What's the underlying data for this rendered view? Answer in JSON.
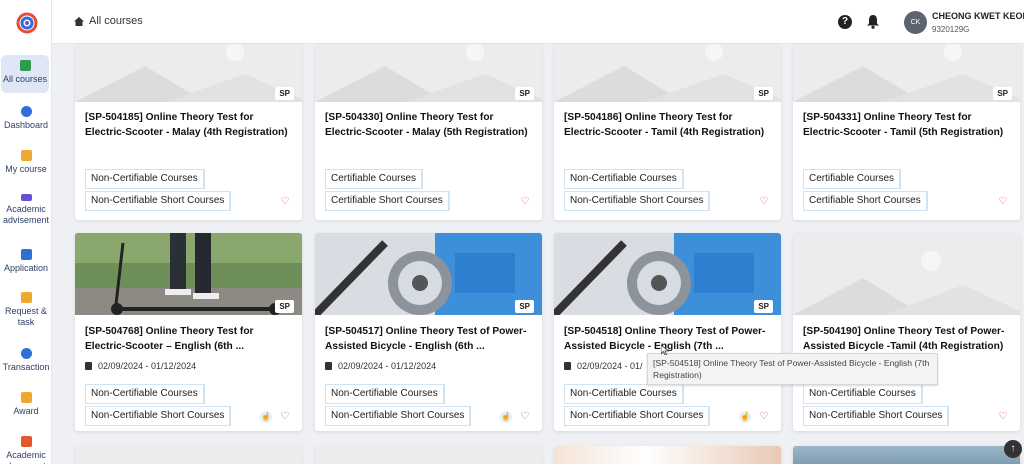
{
  "header": {
    "breadcrumb": "All courses",
    "help_icon": "?",
    "user": {
      "initials": "CK",
      "name": "CHEONG KWET KEONG",
      "id": "9320129G"
    }
  },
  "sidebar": {
    "items": [
      {
        "label": "All courses",
        "color": "#2e9b4e"
      },
      {
        "label": "Dashboard",
        "color": "#2f6fd6"
      },
      {
        "label": "My course",
        "color": "#f0a830"
      },
      {
        "label": "Academic advisement",
        "color": "#6b4fd6"
      },
      {
        "label": "Application",
        "color": "#2f6fd6"
      },
      {
        "label": "Request & task",
        "color": "#f0a830"
      },
      {
        "label": "Transaction",
        "color": "#2f6fd6"
      },
      {
        "label": "Award",
        "color": "#f0a830"
      },
      {
        "label": "Academic document",
        "color": "#e2572e"
      }
    ]
  },
  "cards": [
    {
      "badge": "SP",
      "title": "[SP-504185] Online Theory Test for Electric-Scooter - Malay (4th Registration)",
      "date": "",
      "tags": [
        "Non-Certifiable Courses",
        "Non-Certifiable Short Courses"
      ]
    },
    {
      "badge": "SP",
      "title": "[SP-504330] Online Theory Test for Electric-Scooter - Malay (5th Registration)",
      "date": "",
      "tags": [
        "Certifiable Courses",
        "Certifiable Short Courses"
      ]
    },
    {
      "badge": "SP",
      "title": "[SP-504186] Online Theory Test for Electric-Scooter - Tamil (4th Registration)",
      "date": "",
      "tags": [
        "Non-Certifiable Courses",
        "Non-Certifiable Short Courses"
      ]
    },
    {
      "badge": "SP",
      "title": "[SP-504331] Online Theory Test for Electric-Scooter - Tamil (5th Registration)",
      "date": "",
      "tags": [
        "Certifiable Courses",
        "Certifiable Short Courses"
      ]
    },
    {
      "badge": "SP",
      "title": "[SP-504768] Online Theory Test for Electric-Scooter – English (6th ...",
      "date": "02/09/2024 - 01/12/2024",
      "tags": [
        "Non-Certifiable Courses",
        "Non-Certifiable Short Courses"
      ]
    },
    {
      "badge": "SP",
      "title": "[SP-504517] Online Theory Test of Power-Assisted Bicycle - English (6th ...",
      "date": "02/09/2024 - 01/12/2024",
      "tags": [
        "Non-Certifiable Courses",
        "Non-Certifiable Short Courses"
      ]
    },
    {
      "badge": "SP",
      "title": "[SP-504518] Online Theory Test of Power-Assisted Bicycle - English (7th ...",
      "date": "02/09/2024 - 01/",
      "tags": [
        "Non-Certifiable Courses",
        "Non-Certifiable Short Courses"
      ]
    },
    {
      "badge": "SP",
      "title": "[SP-504190] Online Theory Test of Power-Assisted Bicycle -Tamil (4th Registration)",
      "date": "",
      "tags": [
        "Non-Certifiable Courses",
        "Non-Certifiable Short Courses"
      ]
    }
  ],
  "tooltip": "[SP-504518] Online Theory Test of Power-Assisted Bicycle - English (7th Registration)",
  "icons": {
    "heart": "♡",
    "hand": "☝",
    "scroll_top": "↑"
  }
}
